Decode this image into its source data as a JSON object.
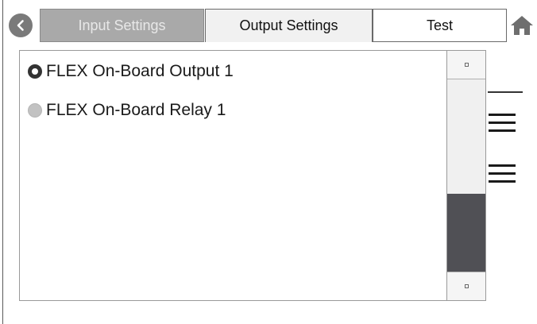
{
  "tabs": {
    "input_label": "Input Settings",
    "output_label": "Output Settings",
    "test_label": "Test",
    "active": "Output Settings"
  },
  "outputs": {
    "items": [
      {
        "label": "FLEX On-Board Output 1",
        "selected": true
      },
      {
        "label": "FLEX On-Board Relay 1",
        "selected": false
      }
    ]
  },
  "icons": {
    "back": "back-arrow-icon",
    "home": "home-icon",
    "menu": "menu-icon"
  },
  "colors": {
    "inactive_tab": "#a9a9a9",
    "active_tab": "#f1f1f1",
    "scroll_thumb": "#505055",
    "radio_selected": "#333333",
    "radio_unselected": "#c2c2c2"
  }
}
